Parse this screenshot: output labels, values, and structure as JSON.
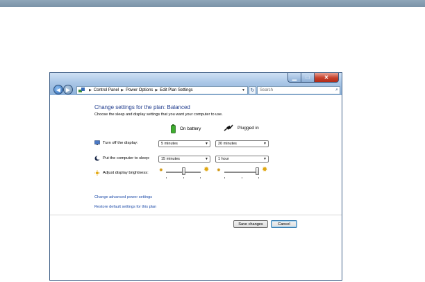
{
  "window": {
    "title_buttons": {
      "minimize": "▁",
      "maximize": "□",
      "close": "✕"
    }
  },
  "address_bar": {
    "crumbs": [
      "Control Panel",
      "Power Options",
      "Edit Plan Settings"
    ],
    "search_placeholder": "Search"
  },
  "content": {
    "heading": "Change settings for the plan: Balanced",
    "subtext": "Choose the sleep and display settings that you want your computer to use.",
    "columns": {
      "battery": "On battery",
      "plugged": "Plugged in"
    },
    "rows": [
      {
        "label": "Turn off the display:",
        "battery_value": "5 minutes",
        "plugged_value": "20 minutes"
      },
      {
        "label": "Put the computer to sleep:",
        "battery_value": "15 minutes",
        "plugged_value": "1 hour"
      },
      {
        "label": "Adjust display brightness:",
        "battery_level": 0.5,
        "plugged_level": 1.0
      }
    ],
    "links": {
      "advanced": "Change advanced power settings",
      "restore": "Restore default settings for this plan"
    },
    "buttons": {
      "save": "Save changes",
      "cancel": "Cancel"
    }
  },
  "colors": {
    "heading": "#1e3a8c",
    "link": "#1c4aa8",
    "page_bar": "#8fa6b9",
    "title_bar": "#a9c6e6"
  },
  "icons": {
    "back": "back-arrow-icon",
    "forward": "forward-arrow-icon",
    "control_panel": "control-panel-icon",
    "refresh": "refresh-icon",
    "search": "search-icon",
    "battery": "battery-icon",
    "plug": "plug-icon",
    "monitor": "monitor-icon",
    "sleep": "moon-icon",
    "brightness": "sun-icon"
  }
}
